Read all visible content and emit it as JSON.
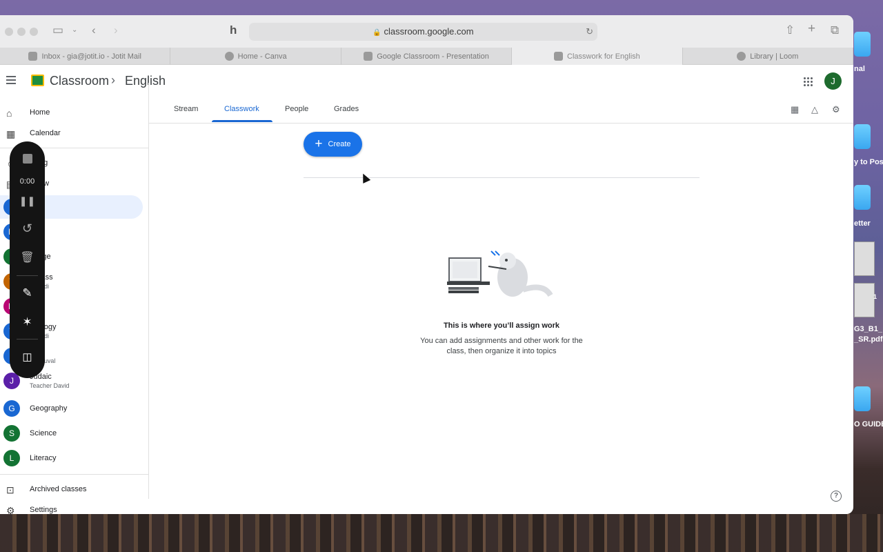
{
  "browser": {
    "url": "classroom.google.com",
    "tabs": [
      {
        "label": "Inbox - gia@jotit.io - Jotit Mail",
        "icon": "mail-icon"
      },
      {
        "label": "Home - Canva",
        "icon": "canva-icon"
      },
      {
        "label": "Google Classroom - Presentation",
        "icon": "slides-icon"
      },
      {
        "label": "Classwork for English",
        "icon": "classroom-icon",
        "active": true
      },
      {
        "label": "Library | Loom",
        "icon": "loom-icon"
      }
    ]
  },
  "header": {
    "brand": "Classroom",
    "breadcrumb_sep": "›",
    "current_class": "English",
    "user_initial": "J"
  },
  "sidebar": {
    "nav": [
      {
        "label": "Home",
        "icon": "home-icon"
      },
      {
        "label": "Calendar",
        "icon": "calendar-icon"
      }
    ],
    "teaching": [
      {
        "label": "ching",
        "icon": "people-icon"
      },
      {
        "label": "eview",
        "icon": "review-icon"
      }
    ],
    "classes": [
      {
        "initial": "E",
        "name": "lish",
        "sub": "",
        "color": "#1967d2",
        "selected": true
      },
      {
        "initial": "M",
        "name": "th",
        "sub": "",
        "color": "#1967d2"
      },
      {
        "initial": "L",
        "name": "guage",
        "sub": "",
        "color": "#137333"
      },
      {
        "initial": "T",
        "name": "t Class",
        "sub": "her Adi",
        "color": "#c26401"
      },
      {
        "initial": "M",
        "name": "h",
        "sub": "",
        "color": "#b80672"
      },
      {
        "initial": "T",
        "name": "nnology",
        "sub": "her Adi",
        "color": "#1967d2"
      },
      {
        "initial": "E",
        "name": "lish",
        "sub": "her Yuval",
        "color": "#1967d2"
      },
      {
        "initial": "J",
        "name": "Judaic",
        "sub": "Teacher David",
        "color": "#5b1fa8"
      },
      {
        "initial": "G",
        "name": "Geography",
        "sub": "",
        "color": "#1967d2"
      },
      {
        "initial": "S",
        "name": "Science",
        "sub": "",
        "color": "#137333"
      },
      {
        "initial": "L",
        "name": "Literacy",
        "sub": "",
        "color": "#137333"
      }
    ],
    "bottom": [
      {
        "label": "Archived classes",
        "icon": "archive-icon"
      },
      {
        "label": "Settings",
        "icon": "gear-icon"
      }
    ]
  },
  "main": {
    "tabs": [
      "Stream",
      "Classwork",
      "People",
      "Grades"
    ],
    "active_tab": "Classwork",
    "create_label": "Create",
    "empty_title": "This is where you’ll assign work",
    "empty_body": "You can add assignments and other work for the class, then organize it into topics"
  },
  "recorder": {
    "timer": "0:00"
  },
  "desktop": {
    "labels": [
      "nal",
      "y to Post",
      "etter",
      "rt",
      "1",
      "G3_B1_",
      "_SR.pdf",
      "O GUIDE"
    ]
  }
}
